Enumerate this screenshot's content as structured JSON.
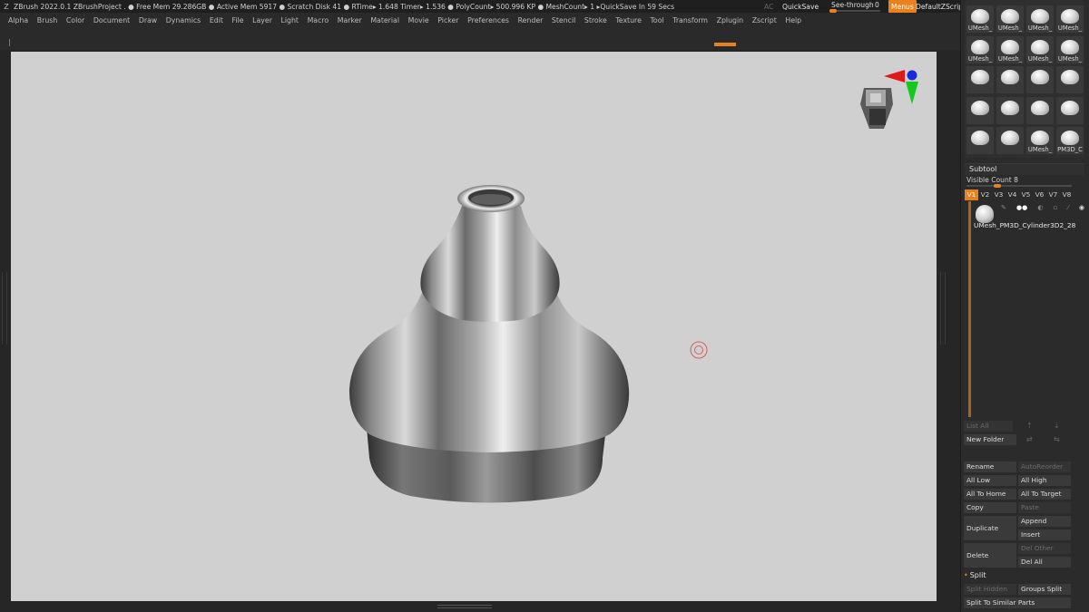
{
  "status_bar": {
    "text": "ZBrush 2022.0.1    ZBrushProject   . ● Free Mem 29.286GB ● Active Mem 5917 ● Scratch Disk 41 ●  RTime▸ 1.648 Timer▸ 1.536 ● PolyCount▸ 500.996 KP  ● MeshCount▸ 1   ▸QuickSave In 59 Secs",
    "ac": "AC",
    "quicksave": "QuickSave",
    "see_through_label": "See-through",
    "see_through_value": "0",
    "see_through_level": 0,
    "menus": "Menus",
    "default_zscript": "DefaultZScript"
  },
  "menu_bar": [
    "Alpha",
    "Brush",
    "Color",
    "Document",
    "Draw",
    "Dynamics",
    "Edit",
    "File",
    "Layer",
    "Light",
    "Macro",
    "Marker",
    "Material",
    "Movie",
    "Picker",
    "Preferences",
    "Render",
    "Stencil",
    "Stroke",
    "Texture",
    "Tool",
    "Transform",
    "Zplugin",
    "Zscript",
    "Help"
  ],
  "mesh_library": {
    "labels": [
      [
        "UMesh_",
        "UMesh_",
        "UMesh_",
        "UMesh_"
      ],
      [
        "UMesh_",
        "UMesh_",
        "UMesh_",
        "UMesh_"
      ],
      [
        "",
        "",
        "",
        ""
      ],
      [
        "",
        "",
        "",
        ""
      ],
      [
        "",
        "",
        "UMesh_",
        "PM3D_C"
      ]
    ]
  },
  "subtool": {
    "title": "Subtool",
    "visible_count": "Visible Count 8",
    "visible_count_level": 0.3,
    "version_tabs": [
      "V1",
      "V2",
      "V3",
      "V4",
      "V5",
      "V6",
      "V7",
      "V8"
    ],
    "item_name": "UMesh_PM3D_Cylinder3D2_28",
    "buttons": {
      "list_all": "List All",
      "new_folder": "New Folder",
      "rename": "Rename",
      "auto_reorder": "AutoReorder",
      "all_low": "All Low",
      "all_high": "All High",
      "all_to_home": "All To Home",
      "all_to_target": "All To Target",
      "copy": "Copy",
      "paste": "Paste",
      "duplicate": "Duplicate",
      "append": "Append",
      "insert": "Insert",
      "delete": "Delete",
      "del_other": "Del Other",
      "del_all": "Del All"
    }
  },
  "split": {
    "title": "Split",
    "split_hidden": "Split Hidden",
    "groups_split": "Groups Split",
    "split_to_similar": "Split To Similar Parts"
  },
  "colors": {
    "accent": "#e8821e",
    "canvas": "#d0d0d0",
    "panel": "#2b2b2b"
  }
}
